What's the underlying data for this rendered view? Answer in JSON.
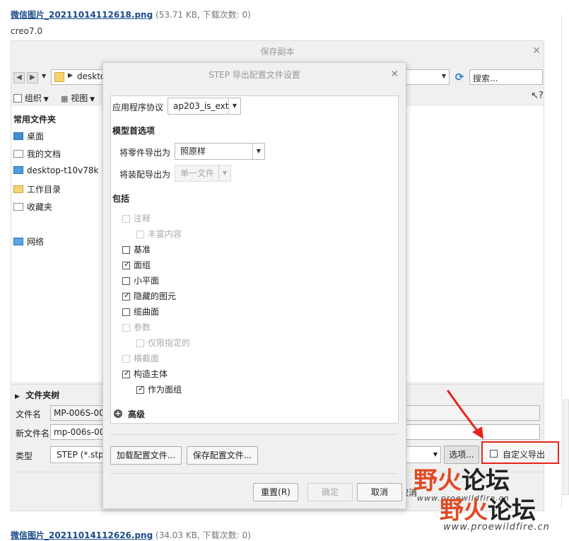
{
  "forum": {
    "top_filename": "微信图片_20211014112618.png",
    "top_meta": "(53.71 KB, 下载次数: 0)",
    "caption": "creo7.0",
    "bottom_filename": "微信图片_20211014112626.png",
    "bottom_meta": "(34.03 KB, 下载次数: 0)"
  },
  "save_dialog": {
    "title": "保存副本",
    "address_text": "deskto",
    "search_placeholder": "搜索...",
    "toolbar": {
      "organize": "组织",
      "views": "视图"
    },
    "nav_header": "常用文件夹",
    "nav_items": [
      "桌面",
      "我的文档",
      "desktop-t10v78k",
      "工作目录",
      "收藏夹",
      "网络"
    ],
    "folder_tree": "文件夹树",
    "filename_label": "文件名",
    "filename_value": "MP-006S-00",
    "new_filename_label": "新文件名",
    "new_filename_value": "mp-006s-00",
    "type_label": "类型",
    "type_value": "STEP (*.stp)",
    "options_button": "选项...",
    "custom_export_label": "自定义导出",
    "cancel_partial": "取消"
  },
  "step_dialog": {
    "title": "STEP 导出配置文件设置",
    "protocol_label": "应用程序协议",
    "protocol_value": "ap203_is_ext",
    "model_section": "模型首选项",
    "part_export_label": "将零件导出为",
    "part_export_value": "照原样",
    "asm_export_label": "将装配导出为",
    "asm_export_value": "单一文件",
    "include_section": "包括",
    "checkboxes": [
      {
        "label": "注释",
        "checked": false,
        "disabled": true
      },
      {
        "label": "丰富内容",
        "checked": false,
        "disabled": true
      },
      {
        "label": "基准",
        "checked": false,
        "disabled": false
      },
      {
        "label": "面组",
        "checked": true,
        "disabled": false
      },
      {
        "label": "小平面",
        "checked": false,
        "disabled": false
      },
      {
        "label": "隐藏的图元",
        "checked": true,
        "disabled": false
      },
      {
        "label": "缆曲面",
        "checked": false,
        "disabled": false
      },
      {
        "label": "参数",
        "checked": false,
        "disabled": true
      },
      {
        "label": "仅限指定的",
        "checked": false,
        "disabled": true
      },
      {
        "label": "横截面",
        "checked": false,
        "disabled": true
      },
      {
        "label": "构造主体",
        "checked": true,
        "disabled": false
      },
      {
        "label": "作为面组",
        "checked": true,
        "disabled": false
      }
    ],
    "advanced": "高级",
    "load_config": "加载配置文件...",
    "save_config": "保存配置文件...",
    "reset": "重置(R)",
    "ok": "确定",
    "cancel": "取消"
  },
  "watermark": {
    "text_red": "野火",
    "text_black": "论坛",
    "url": "www.proewildfire.cn"
  },
  "colors": {
    "annotation_red": "#e8231e",
    "link_blue": "#1a4a8a"
  }
}
